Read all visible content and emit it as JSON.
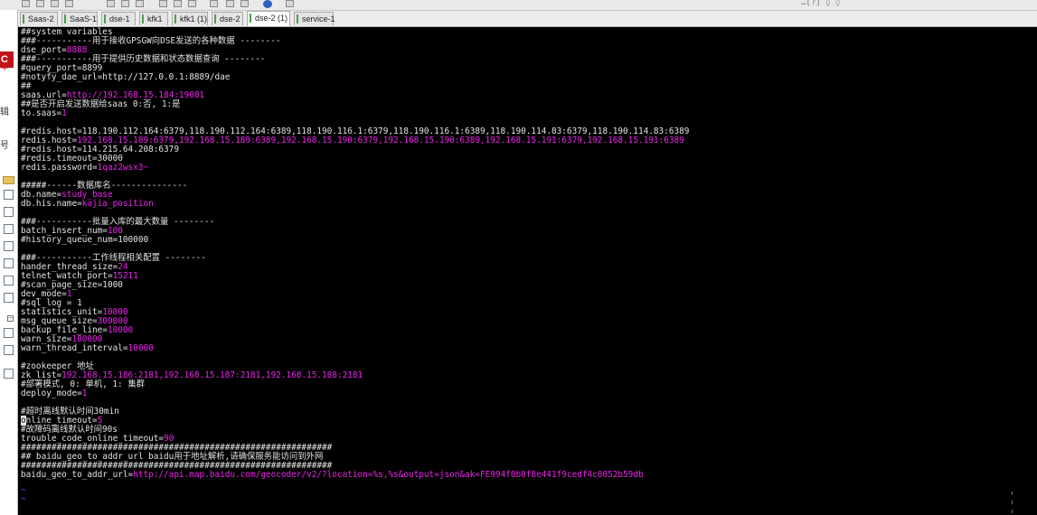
{
  "toolbar": {
    "right_text": "…[?] ◊ ◊"
  },
  "tabs": [
    {
      "label": "Saas-2"
    },
    {
      "label": "SaaS-1"
    },
    {
      "label": "dse-1"
    },
    {
      "label": "kfk1"
    },
    {
      "label": "kfk1 (1)"
    },
    {
      "label": "dse-2"
    },
    {
      "label": "dse-2 (1)",
      "active": true
    },
    {
      "label": "service-1"
    }
  ],
  "left_window": {
    "logo": "C",
    "label1": "车",
    "label2": "辑",
    "label3": "号"
  },
  "colors": {
    "terminal_bg": "#000000",
    "value_color": "#ee22ee",
    "text_color": "#e4e4e4",
    "tilde_color": "#5a5aff"
  },
  "terminal": {
    "lines": [
      [
        {
          "t": "##system variables",
          "c": "c"
        }
      ],
      [
        {
          "t": "###-----------用于接收GPSGW向DSE发送的各种数据 --------",
          "c": "c"
        }
      ],
      [
        {
          "t": "dse_port=",
          "c": "k"
        },
        {
          "t": "8888",
          "c": "v"
        }
      ],
      [
        {
          "t": "###-----------用于提供历史数据和状态数据查询 --------",
          "c": "c"
        }
      ],
      [
        {
          "t": "#query_port=8899",
          "c": "c"
        }
      ],
      [
        {
          "t": "#notyfy_dae_url=http://127.0.0.1:8889/dae",
          "c": "c"
        }
      ],
      [
        {
          "t": "##",
          "c": "c"
        }
      ],
      [
        {
          "t": "saas.url=",
          "c": "k"
        },
        {
          "t": "http://192.168.15.184:19081",
          "c": "v"
        }
      ],
      [
        {
          "t": "##是否开启发送数据给saas 0:否, 1:是",
          "c": "c"
        }
      ],
      [
        {
          "t": "to.saas=",
          "c": "k"
        },
        {
          "t": "1",
          "c": "v"
        }
      ],
      [
        {
          "t": "",
          "c": "c"
        }
      ],
      [
        {
          "t": "#redis.host=118.190.112.164:6379,118.190.112.164:6389,118.190.116.1:6379,118.190.116.1:6389,118.190.114.83:6379,118.190.114.83:6389",
          "c": "c"
        }
      ],
      [
        {
          "t": "redis.host=",
          "c": "k"
        },
        {
          "t": "192.168.15.189:6379,192.168.15.189:6389,192.168.15.190:6379,192.168.15.190:6389,192.168.15.191:6379,192.168.15.191:6389",
          "c": "v"
        }
      ],
      [
        {
          "t": "#redis.host=114.215.64.208:6379",
          "c": "c"
        }
      ],
      [
        {
          "t": "#redis.timeout=30000",
          "c": "c"
        }
      ],
      [
        {
          "t": "redis.password=",
          "c": "k"
        },
        {
          "t": "1qaz2wsx3~",
          "c": "v"
        }
      ],
      [
        {
          "t": "",
          "c": "c"
        }
      ],
      [
        {
          "t": "#####------数据库名---------------",
          "c": "c"
        }
      ],
      [
        {
          "t": "db.name=",
          "c": "k"
        },
        {
          "t": "study_base",
          "c": "v"
        }
      ],
      [
        {
          "t": "db.his.name=",
          "c": "k"
        },
        {
          "t": "kajia_position",
          "c": "v"
        }
      ],
      [
        {
          "t": "",
          "c": "c"
        }
      ],
      [
        {
          "t": "###-----------批量入库的最大数量 --------",
          "c": "c"
        }
      ],
      [
        {
          "t": "batch_insert_num=",
          "c": "k"
        },
        {
          "t": "100",
          "c": "v"
        }
      ],
      [
        {
          "t": "#history_queue_num=100000",
          "c": "c"
        }
      ],
      [
        {
          "t": "",
          "c": "c"
        }
      ],
      [
        {
          "t": "###-----------工作线程相关配置 --------",
          "c": "c"
        }
      ],
      [
        {
          "t": "hander_thread_size=",
          "c": "k"
        },
        {
          "t": "24",
          "c": "v"
        }
      ],
      [
        {
          "t": "telnet_watch_port=",
          "c": "k"
        },
        {
          "t": "15211",
          "c": "v"
        }
      ],
      [
        {
          "t": "#scan_page_size=1000",
          "c": "c"
        }
      ],
      [
        {
          "t": "dev_mode=",
          "c": "k"
        },
        {
          "t": "1",
          "c": "v"
        }
      ],
      [
        {
          "t": "#sql_log = 1",
          "c": "c"
        }
      ],
      [
        {
          "t": "statistics_unit=",
          "c": "k"
        },
        {
          "t": "10000",
          "c": "v"
        }
      ],
      [
        {
          "t": "msg_queue_size=",
          "c": "k"
        },
        {
          "t": "300000",
          "c": "v"
        }
      ],
      [
        {
          "t": "backup_file_line=",
          "c": "k"
        },
        {
          "t": "10000",
          "c": "v"
        }
      ],
      [
        {
          "t": "warn_size=",
          "c": "k"
        },
        {
          "t": "100000",
          "c": "v"
        }
      ],
      [
        {
          "t": "warn_thread_interval=",
          "c": "k"
        },
        {
          "t": "10000",
          "c": "v"
        }
      ],
      [
        {
          "t": "",
          "c": "c"
        }
      ],
      [
        {
          "t": "#zookeeper 地址",
          "c": "c"
        }
      ],
      [
        {
          "t": "zk_list=",
          "c": "k"
        },
        {
          "t": "192.168.15.186:2181,192.168.15.187:2181,192.168.15.188:2181",
          "c": "v"
        }
      ],
      [
        {
          "t": "#部署模式, 0: 单机, 1: 集群",
          "c": "c"
        }
      ],
      [
        {
          "t": "deploy_mode=",
          "c": "k"
        },
        {
          "t": "1",
          "c": "v"
        }
      ],
      [
        {
          "t": "",
          "c": "c"
        }
      ],
      [
        {
          "t": "#超时离线默认时间30min",
          "c": "c"
        }
      ],
      [
        {
          "t": "o",
          "c": "cur"
        },
        {
          "t": "nline_timeout=",
          "c": "k"
        },
        {
          "t": "5",
          "c": "v"
        }
      ],
      [
        {
          "t": "#故障码离线默认时间90s",
          "c": "c"
        }
      ],
      [
        {
          "t": "trouble_code_online_timeout=",
          "c": "k"
        },
        {
          "t": "90",
          "c": "v"
        }
      ],
      [
        {
          "t": "#############################################################",
          "c": "c"
        }
      ],
      [
        {
          "t": "## baidu_geo_to_addr_url baidu用于地址解析,请确保服务能访问到外网",
          "c": "c"
        }
      ],
      [
        {
          "t": "#############################################################",
          "c": "c"
        }
      ],
      [
        {
          "t": "baidu_geo_to_addr_url=",
          "c": "k"
        },
        {
          "t": "http://api.map.baidu.com/geocoder/v2/?location=%s,%s&output=json&ak=FE994f0b0f8e441f9cedf4c8052b59db",
          "c": "v"
        }
      ]
    ],
    "tilde_lines": [
      "~",
      "~"
    ]
  }
}
